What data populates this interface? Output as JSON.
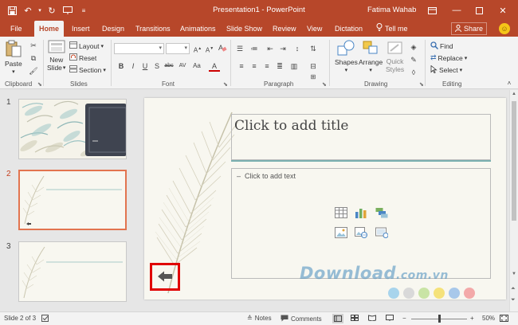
{
  "window": {
    "title": "Presentation1 - PowerPoint",
    "user": "Fatima Wahab"
  },
  "tabs": [
    {
      "label": "File"
    },
    {
      "label": "Home"
    },
    {
      "label": "Insert"
    },
    {
      "label": "Design"
    },
    {
      "label": "Transitions"
    },
    {
      "label": "Animations"
    },
    {
      "label": "Slide Show"
    },
    {
      "label": "Review"
    },
    {
      "label": "View"
    },
    {
      "label": "Dictation"
    },
    {
      "label": "Tell me"
    }
  ],
  "share_label": "Share",
  "ribbon": {
    "clipboard": {
      "paste": "Paste",
      "label": "Clipboard"
    },
    "slides": {
      "new_slide": "New",
      "new_slide2": "Slide",
      "layout": "Layout",
      "reset": "Reset",
      "section": "Section",
      "label": "Slides"
    },
    "font": {
      "label": "Font",
      "buttons": [
        "B",
        "I",
        "U",
        "S",
        "abc",
        "AV",
        "Aa",
        "A"
      ]
    },
    "paragraph": {
      "label": "Paragraph"
    },
    "drawing": {
      "shapes": "Shapes",
      "arrange": "Arrange",
      "quick": "Quick",
      "styles": "Styles",
      "label": "Drawing"
    },
    "editing": {
      "find": "Find",
      "replace": "Replace",
      "select": "Select",
      "label": "Editing"
    }
  },
  "thumbnails": [
    {
      "number": "1"
    },
    {
      "number": "2"
    },
    {
      "number": "3"
    }
  ],
  "slide": {
    "title_placeholder": "Click to add title",
    "body_placeholder": "Click to add text",
    "bullet": "–"
  },
  "watermark": {
    "main": "Download",
    "suffix": ".com.vn"
  },
  "watermark_colors": [
    "#a8d4ec",
    "#d9d9d9",
    "#c9e4a5",
    "#f5e27a",
    "#a8c8ea",
    "#f3a9a9"
  ],
  "status": {
    "slide_info": "Slide 2 of 3",
    "notes": "Notes",
    "comments": "Comments",
    "zoom": "50%",
    "zoom_fraction": 0.5
  },
  "colors": {
    "accent": "#b7472a",
    "selected_thumb": "#e2744f",
    "highlight_box": "#e00000"
  }
}
